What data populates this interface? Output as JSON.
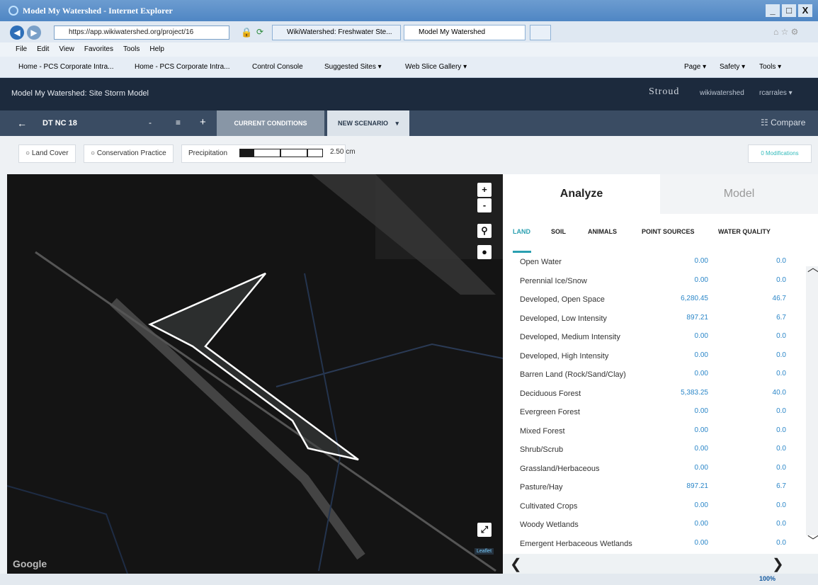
{
  "window": {
    "title": "Model My Watershed - Internet Explorer",
    "buttons": [
      "_",
      "□",
      "X"
    ]
  },
  "addressbar": {
    "url": "https://app.wikiwatershed.org/project/16",
    "tabs": [
      {
        "label": "WikiWatershed: Freshwater Ste..."
      },
      {
        "label": "Model My Watershed"
      }
    ]
  },
  "menubar": [
    "File",
    "Edit",
    "View",
    "Favorites",
    "Tools",
    "Help"
  ],
  "favorites": [
    "Home - PCS Corporate Intra...",
    "Home - PCS Corporate Intra...",
    "Control Console",
    "Suggested Sites ▾",
    "Web Slice Gallery ▾"
  ],
  "commandbar": [
    "Page ▾",
    "Safety ▾",
    "Tools ▾"
  ],
  "app": {
    "title": "Model My Watershed: Site Storm Model",
    "logo": "Stroud",
    "user_links": [
      "wikiwatershed",
      "rcarrales ▾"
    ]
  },
  "toolbar": {
    "back": "←",
    "project": "DT NC 18",
    "dash": "-",
    "menu": "≡",
    "plus": "+",
    "tab_current": "CURRENT CONDITIONS",
    "tab_new": "NEW SCENARIO",
    "tab_new_caret": "▾",
    "compare": "☷ Compare"
  },
  "subbar": {
    "land_cover": "○ Land Cover",
    "conservation": "○ Conservation Practice",
    "precip_label": "Precipitation",
    "precip_value": "2.50 cm",
    "precip_fraction": 0.17,
    "modifications": "0 Modifications"
  },
  "map": {
    "zoom_in": "+",
    "zoom_out": "-",
    "google": "Google",
    "leaflet": "Leaflet",
    "fullscreen": "⤢"
  },
  "panel": {
    "tab_analyze": "Analyze",
    "tab_model": "Model",
    "subtabs": [
      "LAND",
      "SOIL",
      "ANIMALS",
      "POINT SOURCES",
      "WATER QUALITY"
    ],
    "rows": [
      {
        "name": "Open Water",
        "area": "0.00",
        "pct": "0.0"
      },
      {
        "name": "Perennial Ice/Snow",
        "area": "0.00",
        "pct": "0.0"
      },
      {
        "name": "Developed, Open Space",
        "area": "6,280.45",
        "pct": "46.7"
      },
      {
        "name": "Developed, Low Intensity",
        "area": "897.21",
        "pct": "6.7"
      },
      {
        "name": "Developed, Medium Intensity",
        "area": "0.00",
        "pct": "0.0"
      },
      {
        "name": "Developed, High Intensity",
        "area": "0.00",
        "pct": "0.0"
      },
      {
        "name": "Barren Land (Rock/Sand/Clay)",
        "area": "0.00",
        "pct": "0.0"
      },
      {
        "name": "Deciduous Forest",
        "area": "5,383.25",
        "pct": "40.0"
      },
      {
        "name": "Evergreen Forest",
        "area": "0.00",
        "pct": "0.0"
      },
      {
        "name": "Mixed Forest",
        "area": "0.00",
        "pct": "0.0"
      },
      {
        "name": "Shrub/Scrub",
        "area": "0.00",
        "pct": "0.0"
      },
      {
        "name": "Grassland/Herbaceous",
        "area": "0.00",
        "pct": "0.0"
      },
      {
        "name": "Pasture/Hay",
        "area": "897.21",
        "pct": "6.7"
      },
      {
        "name": "Cultivated Crops",
        "area": "0.00",
        "pct": "0.0"
      },
      {
        "name": "Woody Wetlands",
        "area": "0.00",
        "pct": "0.0"
      },
      {
        "name": "Emergent Herbaceous Wetlands",
        "area": "0.00",
        "pct": "0.0"
      }
    ]
  },
  "status": {
    "zoom": "100%"
  }
}
